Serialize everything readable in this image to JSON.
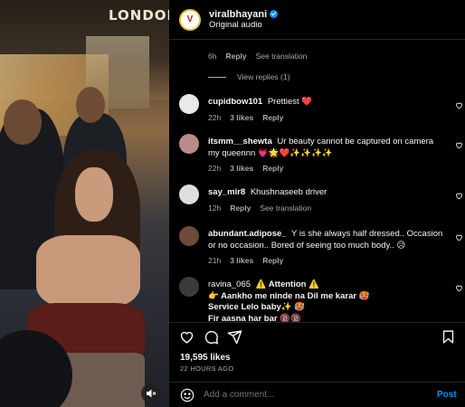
{
  "post": {
    "username": "viralbhayani",
    "audio": "Original audio",
    "avatar_text": "V",
    "store_sign": "LONDON"
  },
  "first_comment_meta": {
    "time": "6h",
    "reply": "Reply",
    "translation": "See translation"
  },
  "view_replies": "View replies (1)",
  "comments": [
    {
      "username": "cupidbow101",
      "text": "Prettiest ❤️",
      "time": "22h",
      "likes": "3 likes",
      "reply": "Reply",
      "extra": "",
      "avatar_color": "#e9e9e9"
    },
    {
      "username": "itsmm__shewta",
      "text": "Ur beauty cannot be captured on camera my queennn 💗🌟❤️✨✨✨✨",
      "time": "22h",
      "likes": "3 likes",
      "reply": "Reply",
      "extra": "",
      "avatar_color": "#b78c8a"
    },
    {
      "username": "say_mir8",
      "text": "Khushnaseeb driver",
      "time": "12h",
      "likes": "",
      "reply": "Reply",
      "extra": "See translation",
      "avatar_color": "#dedede"
    },
    {
      "username": "abundant.adipose_",
      "text": "Y is she always half dressed.. Occasion or no occasion.. Bored of seeing too much body.. 😥",
      "time": "21h",
      "likes": "3 likes",
      "reply": "Reply",
      "extra": "",
      "avatar_color": "#6d4a3a"
    },
    {
      "username": "ravina_065",
      "text": "⚠️ Attention ⚠️",
      "lines": [
        "👉 Aankho me ninde na Dil me karar 🥵",
        "Service Lelo baby✨ 🥵",
        "Fir aasna har bar 🔞🔞"
      ],
      "time": "",
      "likes": "",
      "reply": "",
      "extra": "",
      "avatar_color": "#3b3b3b"
    }
  ],
  "stats": {
    "likes": "19,595 likes",
    "time": "22 HOURS AGO"
  },
  "composer": {
    "placeholder": "Add a comment...",
    "post_label": "Post"
  },
  "colors": {
    "accent": "#0095f6",
    "like_red": "#ed4956",
    "muted": "#a8a8a8"
  },
  "icons": [
    "heart-icon",
    "comment-icon",
    "share-icon",
    "save-icon",
    "emoji-icon",
    "mute-icon",
    "verified-icon"
  ]
}
